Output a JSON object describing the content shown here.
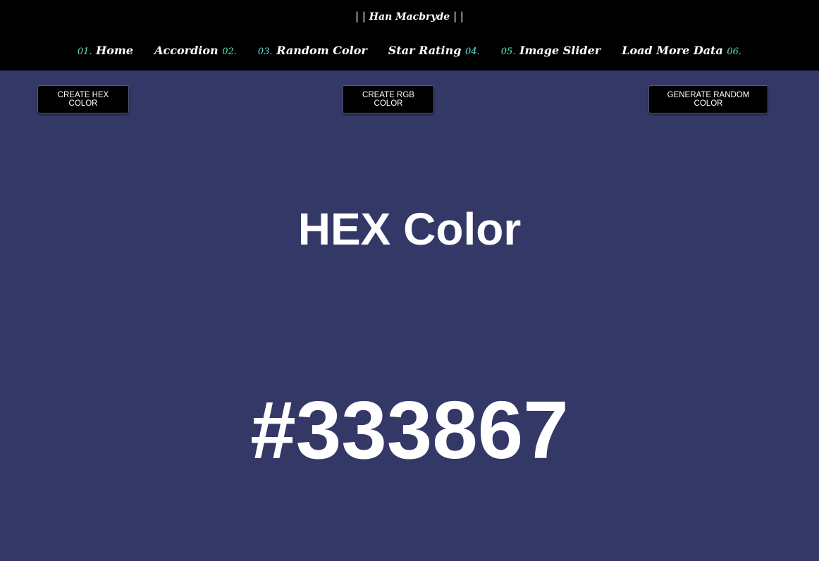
{
  "header": {
    "brand_prefix": "| |",
    "brand_name": "Han Macbryde",
    "brand_suffix": "| |"
  },
  "nav": {
    "items": [
      {
        "num": "01.",
        "label": "Home"
      },
      {
        "label": "Accordion",
        "num": "02."
      },
      {
        "num": "03.",
        "label": "Random Color"
      },
      {
        "label": "Star Rating",
        "num": "04."
      },
      {
        "num": "05.",
        "label": "Image Slider"
      },
      {
        "label": "Load More Data",
        "num": "06."
      }
    ]
  },
  "buttons": {
    "hex_label": "CREATE HEX COLOR",
    "rgb_label": "CREATE RGB COLOR",
    "random_label": "GENERATE RANDOM COLOR"
  },
  "display": {
    "color_type": "HEX Color",
    "color_value": "#333867"
  },
  "colors": {
    "background": "#333867",
    "topbar": "#000000",
    "accent": "#5fe0c8",
    "text": "#ffffff"
  }
}
